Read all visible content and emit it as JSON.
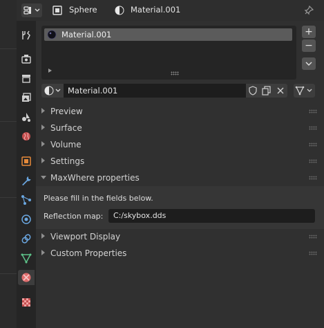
{
  "header": {
    "object_name": "Sphere",
    "material_name": "Material.001"
  },
  "material_slots": {
    "items": [
      {
        "label": "Material.001"
      }
    ],
    "add_label": "+",
    "remove_label": "−",
    "menu_label": "⌄"
  },
  "material_selector": {
    "name": "Material.001"
  },
  "sections": [
    {
      "title": "Preview",
      "expanded": false
    },
    {
      "title": "Surface",
      "expanded": false
    },
    {
      "title": "Volume",
      "expanded": false
    },
    {
      "title": "Settings",
      "expanded": false
    },
    {
      "title": "MaxWhere properties",
      "expanded": true
    },
    {
      "title": "Viewport Display",
      "expanded": false
    },
    {
      "title": "Custom Properties",
      "expanded": false
    }
  ],
  "maxwhere": {
    "hint": "Please fill in the fields below.",
    "reflection_label": "Reflection map:",
    "reflection_value": "C:/skybox.dds"
  },
  "colors": {
    "material_tab": "#e06d6d",
    "accent_orange": "#e68a3a",
    "accent_blue": "#6aa6e0",
    "accent_green": "#5ec48a"
  }
}
